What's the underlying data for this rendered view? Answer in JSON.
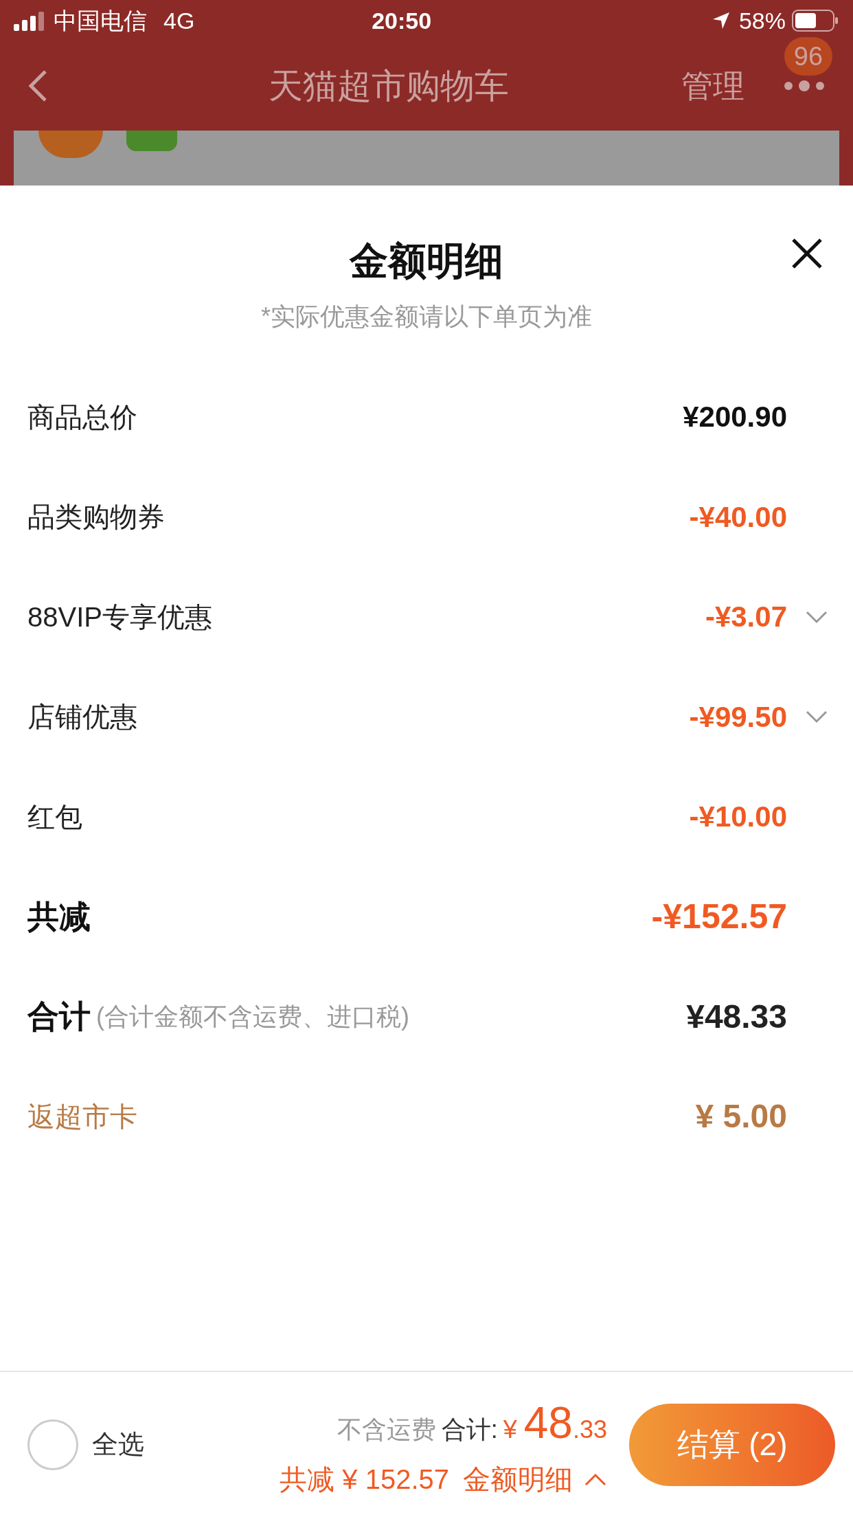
{
  "status_bar": {
    "carrier": "中国电信",
    "network": "4G",
    "time": "20:50",
    "battery": "58%"
  },
  "nav": {
    "title": "天猫超市购物车",
    "manage": "管理",
    "badge": "96"
  },
  "sheet": {
    "title": "金额明细",
    "subtitle": "*实际优惠金额请以下单页为准",
    "rows": [
      {
        "kind": "price",
        "label": "商品总价",
        "value": "¥200.90",
        "expandable": false
      },
      {
        "kind": "discount",
        "label": "品类购物券",
        "value": "-¥40.00",
        "expandable": false
      },
      {
        "kind": "discount",
        "label": "88VIP专享优惠",
        "value": "-¥3.07",
        "expandable": true
      },
      {
        "kind": "discount",
        "label": "店铺优惠",
        "value": "-¥99.50",
        "expandable": true
      },
      {
        "kind": "discount",
        "label": "红包",
        "value": "-¥10.00",
        "expandable": false
      },
      {
        "kind": "total_discount",
        "label": "共减",
        "value": "-¥152.57",
        "expandable": false
      },
      {
        "kind": "sum",
        "label": "合计",
        "note": "(合计金额不含运费、进口税)",
        "value": "¥48.33",
        "expandable": false
      },
      {
        "kind": "rebate",
        "label": "返超市卡",
        "value": "¥ 5.00",
        "expandable": false
      }
    ]
  },
  "bottom_bar": {
    "select_all": {
      "label": "全选",
      "checked": false
    },
    "shipping_note": "不含运费",
    "total_label": "合计:",
    "currency": "¥",
    "total_int": "48",
    "total_dec": ".33",
    "saved": "共减 ¥ 152.57",
    "detail_link": "金额明细",
    "checkout": "结算 (2)"
  }
}
